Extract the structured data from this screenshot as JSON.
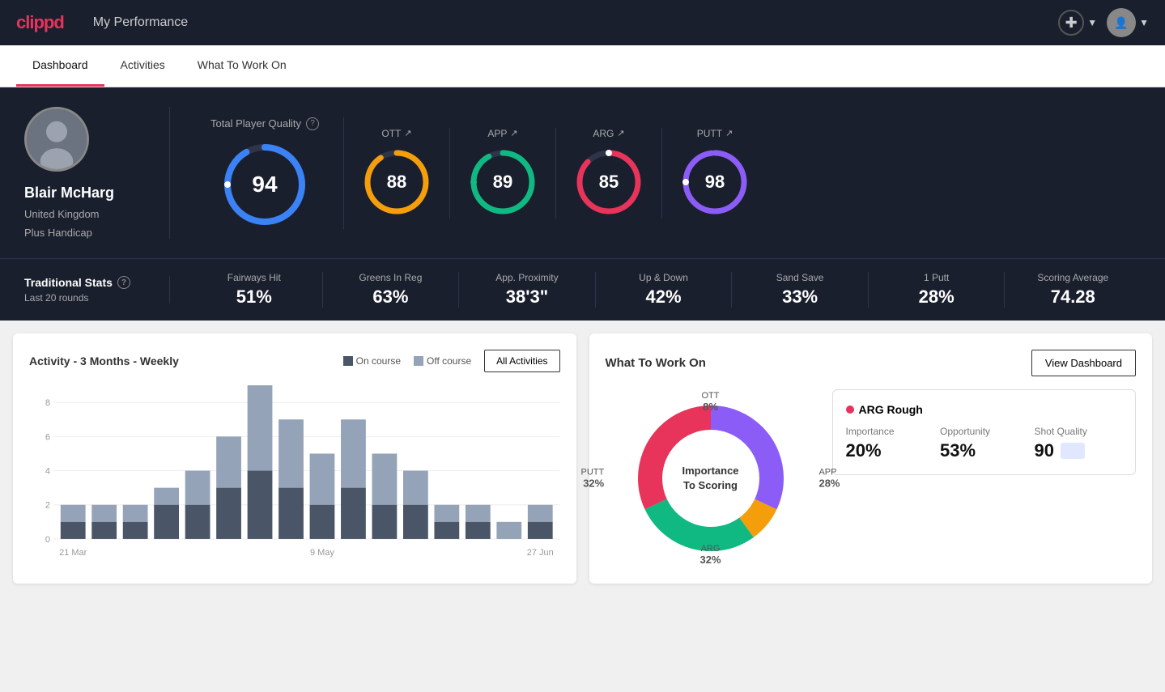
{
  "app": {
    "logo": "clippd",
    "header_title": "My Performance"
  },
  "tabs": [
    {
      "label": "Dashboard",
      "active": true
    },
    {
      "label": "Activities",
      "active": false
    },
    {
      "label": "What To Work On",
      "active": false
    }
  ],
  "player": {
    "name": "Blair McHarg",
    "location": "United Kingdom",
    "handicap": "Plus Handicap"
  },
  "scores": {
    "tpq_label": "Total Player Quality",
    "main": {
      "value": "94",
      "color": "#3b82f6"
    },
    "ott": {
      "label": "OTT",
      "value": "88",
      "color": "#f59e0b"
    },
    "app": {
      "label": "APP",
      "value": "89",
      "color": "#10b981"
    },
    "arg": {
      "label": "ARG",
      "value": "85",
      "color": "#e8335a"
    },
    "putt": {
      "label": "PUTT",
      "value": "98",
      "color": "#8b5cf6"
    }
  },
  "traditional_stats": {
    "label": "Traditional Stats",
    "sub": "Last 20 rounds",
    "stats": [
      {
        "label": "Fairways Hit",
        "value": "51%"
      },
      {
        "label": "Greens In Reg",
        "value": "63%"
      },
      {
        "label": "App. Proximity",
        "value": "38'3\""
      },
      {
        "label": "Up & Down",
        "value": "42%"
      },
      {
        "label": "Sand Save",
        "value": "33%"
      },
      {
        "label": "1 Putt",
        "value": "28%"
      },
      {
        "label": "Scoring Average",
        "value": "74.28"
      }
    ]
  },
  "activity_chart": {
    "title": "Activity - 3 Months - Weekly",
    "legend": {
      "on_course": "On course",
      "off_course": "Off course"
    },
    "all_activities_btn": "All Activities",
    "x_labels": [
      "21 Mar",
      "9 May",
      "27 Jun"
    ],
    "y_labels": [
      "0",
      "2",
      "4",
      "6",
      "8"
    ],
    "bars": [
      {
        "on": 1,
        "off": 1
      },
      {
        "on": 1,
        "off": 1
      },
      {
        "on": 1,
        "off": 1
      },
      {
        "on": 2,
        "off": 1
      },
      {
        "on": 2,
        "off": 2
      },
      {
        "on": 3,
        "off": 3
      },
      {
        "on": 4,
        "off": 5
      },
      {
        "on": 3,
        "off": 4
      },
      {
        "on": 2,
        "off": 3
      },
      {
        "on": 3,
        "off": 4
      },
      {
        "on": 2,
        "off": 3
      },
      {
        "on": 2,
        "off": 2
      },
      {
        "on": 1,
        "off": 1
      },
      {
        "on": 1,
        "off": 1
      },
      {
        "on": 0,
        "off": 1
      },
      {
        "on": 1,
        "off": 1
      }
    ]
  },
  "what_to_work_on": {
    "title": "What To Work On",
    "view_dashboard_btn": "View Dashboard",
    "donut_center": "Importance\nTo Scoring",
    "segments": [
      {
        "label": "OTT",
        "pct": "8%",
        "color": "#f59e0b"
      },
      {
        "label": "APP",
        "pct": "28%",
        "color": "#10b981"
      },
      {
        "label": "ARG",
        "pct": "32%",
        "color": "#e8335a"
      },
      {
        "label": "PUTT",
        "pct": "32%",
        "color": "#8b5cf6"
      }
    ],
    "card": {
      "title": "ARG Rough",
      "importance": {
        "label": "Importance",
        "value": "20%"
      },
      "opportunity": {
        "label": "Opportunity",
        "value": "53%"
      },
      "shot_quality": {
        "label": "Shot Quality",
        "value": "90"
      }
    }
  }
}
